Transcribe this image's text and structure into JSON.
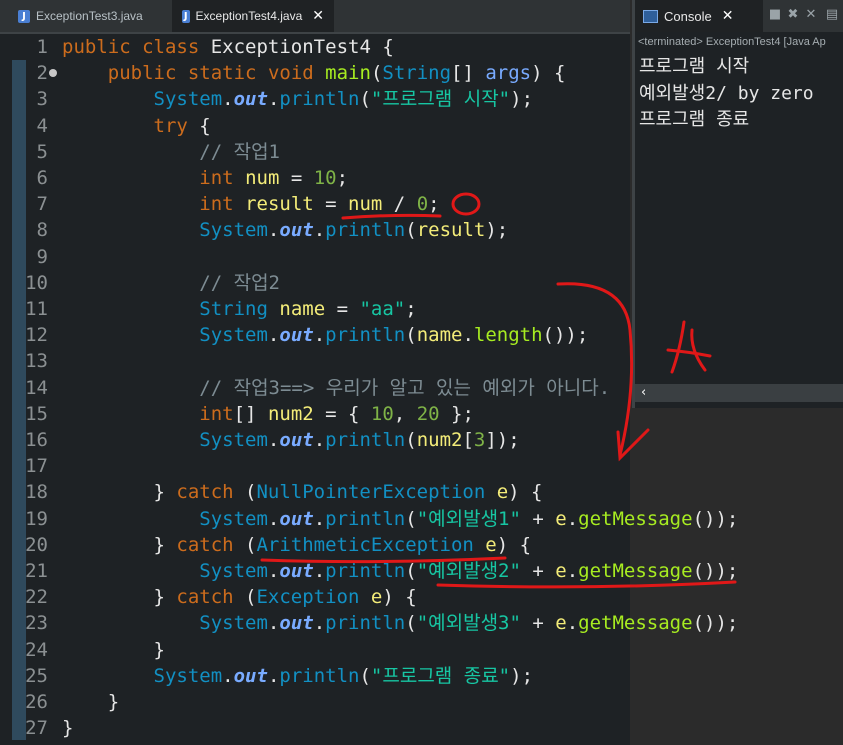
{
  "editor_tabs": [
    {
      "label": "ExceptionTest3.java",
      "active": false
    },
    {
      "label": "ExceptionTest4.java",
      "active": true,
      "close": "✕"
    }
  ],
  "console_tab": {
    "label": "Console",
    "close": "✕"
  },
  "console": {
    "terminated": "<terminated> ExceptionTest4 [Java Ap",
    "output": [
      "프로그램 시작",
      "예외발생2/ by zero",
      "프로그램 종료"
    ],
    "scroll_left": "‹"
  },
  "code_lines": [
    {
      "n": "1",
      "t": [
        [
          "kw",
          "public"
        ],
        [
          "pl",
          " "
        ],
        [
          "kw",
          "class"
        ],
        [
          "pl",
          " ExceptionTest4 {"
        ]
      ]
    },
    {
      "n": "2",
      "t": [
        [
          "pl",
          "    "
        ],
        [
          "kw",
          "public"
        ],
        [
          "pl",
          " "
        ],
        [
          "kw",
          "static"
        ],
        [
          "pl",
          " "
        ],
        [
          "kw",
          "void"
        ],
        [
          "pl",
          " "
        ],
        [
          "meth",
          "main"
        ],
        [
          "pl",
          "("
        ],
        [
          "cls",
          "String"
        ],
        [
          "pl",
          "[] "
        ],
        [
          "fld",
          "args"
        ],
        [
          "pl",
          ") {"
        ]
      ]
    },
    {
      "n": "3",
      "t": [
        [
          "pl",
          "        "
        ],
        [
          "cls",
          "System"
        ],
        [
          "pl",
          "."
        ],
        [
          "static",
          "out"
        ],
        [
          "pl",
          "."
        ],
        [
          "cls",
          "println"
        ],
        [
          "pl",
          "("
        ],
        [
          "str",
          "\"프로그램 시작\""
        ],
        [
          "pl",
          ");"
        ]
      ]
    },
    {
      "n": "4",
      "t": [
        [
          "pl",
          "        "
        ],
        [
          "kw",
          "try"
        ],
        [
          "pl",
          " {"
        ]
      ]
    },
    {
      "n": "5",
      "t": [
        [
          "pl",
          "            "
        ],
        [
          "cmt",
          "// 작업1"
        ]
      ]
    },
    {
      "n": "6",
      "t": [
        [
          "pl",
          "            "
        ],
        [
          "kw",
          "int"
        ],
        [
          "pl",
          " "
        ],
        [
          "var",
          "num"
        ],
        [
          "pl",
          " = "
        ],
        [
          "num",
          "10"
        ],
        [
          "pl",
          ";"
        ]
      ]
    },
    {
      "n": "7",
      "t": [
        [
          "pl",
          "            "
        ],
        [
          "kw",
          "int"
        ],
        [
          "pl",
          " "
        ],
        [
          "var",
          "result"
        ],
        [
          "pl",
          " = "
        ],
        [
          "var",
          "num"
        ],
        [
          "pl",
          " / "
        ],
        [
          "num",
          "0"
        ],
        [
          "pl",
          ";"
        ]
      ]
    },
    {
      "n": "8",
      "t": [
        [
          "pl",
          "            "
        ],
        [
          "cls",
          "System"
        ],
        [
          "pl",
          "."
        ],
        [
          "static",
          "out"
        ],
        [
          "pl",
          "."
        ],
        [
          "cls",
          "println"
        ],
        [
          "pl",
          "("
        ],
        [
          "var",
          "result"
        ],
        [
          "pl",
          ");"
        ]
      ]
    },
    {
      "n": "9",
      "t": [
        [
          "pl",
          ""
        ]
      ]
    },
    {
      "n": "10",
      "t": [
        [
          "pl",
          "            "
        ],
        [
          "cmt",
          "// 작업2"
        ]
      ]
    },
    {
      "n": "11",
      "t": [
        [
          "pl",
          "            "
        ],
        [
          "cls",
          "String"
        ],
        [
          "pl",
          " "
        ],
        [
          "var",
          "name"
        ],
        [
          "pl",
          " = "
        ],
        [
          "str",
          "\"aa\""
        ],
        [
          "pl",
          ";"
        ]
      ]
    },
    {
      "n": "12",
      "t": [
        [
          "pl",
          "            "
        ],
        [
          "cls",
          "System"
        ],
        [
          "pl",
          "."
        ],
        [
          "static",
          "out"
        ],
        [
          "pl",
          "."
        ],
        [
          "cls",
          "println"
        ],
        [
          "pl",
          "("
        ],
        [
          "var",
          "name"
        ],
        [
          "pl",
          "."
        ],
        [
          "meth",
          "length"
        ],
        [
          "pl",
          "());"
        ]
      ]
    },
    {
      "n": "13",
      "t": [
        [
          "pl",
          ""
        ]
      ]
    },
    {
      "n": "14",
      "t": [
        [
          "pl",
          "            "
        ],
        [
          "cmt",
          "// 작업3==> 우리가 알고 있는 예외가 아니다."
        ]
      ]
    },
    {
      "n": "15",
      "t": [
        [
          "pl",
          "            "
        ],
        [
          "kw",
          "int"
        ],
        [
          "pl",
          "[] "
        ],
        [
          "var",
          "num2"
        ],
        [
          "pl",
          " = { "
        ],
        [
          "num",
          "10"
        ],
        [
          "pl",
          ", "
        ],
        [
          "num",
          "20"
        ],
        [
          "pl",
          " };"
        ]
      ]
    },
    {
      "n": "16",
      "t": [
        [
          "pl",
          "            "
        ],
        [
          "cls",
          "System"
        ],
        [
          "pl",
          "."
        ],
        [
          "static",
          "out"
        ],
        [
          "pl",
          "."
        ],
        [
          "cls",
          "println"
        ],
        [
          "pl",
          "("
        ],
        [
          "var",
          "num2"
        ],
        [
          "pl",
          "["
        ],
        [
          "num",
          "3"
        ],
        [
          "pl",
          "]);"
        ]
      ]
    },
    {
      "n": "17",
      "t": [
        [
          "pl",
          ""
        ]
      ]
    },
    {
      "n": "18",
      "t": [
        [
          "pl",
          "        } "
        ],
        [
          "kw",
          "catch"
        ],
        [
          "pl",
          " ("
        ],
        [
          "cls",
          "NullPointerException"
        ],
        [
          "pl",
          " "
        ],
        [
          "var",
          "e"
        ],
        [
          "pl",
          ") {"
        ]
      ]
    },
    {
      "n": "19",
      "t": [
        [
          "pl",
          "            "
        ],
        [
          "cls",
          "System"
        ],
        [
          "pl",
          "."
        ],
        [
          "static",
          "out"
        ],
        [
          "pl",
          "."
        ],
        [
          "cls",
          "println"
        ],
        [
          "pl",
          "("
        ],
        [
          "str",
          "\"예외발생1\""
        ],
        [
          "pl",
          " + "
        ],
        [
          "var",
          "e"
        ],
        [
          "pl",
          "."
        ],
        [
          "meth",
          "getMessage"
        ],
        [
          "pl",
          "());"
        ]
      ]
    },
    {
      "n": "20",
      "t": [
        [
          "pl",
          "        } "
        ],
        [
          "kw",
          "catch"
        ],
        [
          "pl",
          " ("
        ],
        [
          "cls",
          "ArithmeticException"
        ],
        [
          "pl",
          " "
        ],
        [
          "var",
          "e"
        ],
        [
          "pl",
          ") {"
        ]
      ]
    },
    {
      "n": "21",
      "t": [
        [
          "pl",
          "            "
        ],
        [
          "cls",
          "System"
        ],
        [
          "pl",
          "."
        ],
        [
          "static",
          "out"
        ],
        [
          "pl",
          "."
        ],
        [
          "cls",
          "println"
        ],
        [
          "pl",
          "("
        ],
        [
          "str",
          "\"예외발생2\""
        ],
        [
          "pl",
          " + "
        ],
        [
          "var",
          "e"
        ],
        [
          "pl",
          "."
        ],
        [
          "meth",
          "getMessage"
        ],
        [
          "pl",
          "());"
        ]
      ]
    },
    {
      "n": "22",
      "t": [
        [
          "pl",
          "        } "
        ],
        [
          "kw",
          "catch"
        ],
        [
          "pl",
          " ("
        ],
        [
          "cls",
          "Exception"
        ],
        [
          "pl",
          " "
        ],
        [
          "var",
          "e"
        ],
        [
          "pl",
          ") {"
        ]
      ]
    },
    {
      "n": "23",
      "t": [
        [
          "pl",
          "            "
        ],
        [
          "cls",
          "System"
        ],
        [
          "pl",
          "."
        ],
        [
          "static",
          "out"
        ],
        [
          "pl",
          "."
        ],
        [
          "cls",
          "println"
        ],
        [
          "pl",
          "("
        ],
        [
          "str",
          "\"예외발생3\""
        ],
        [
          "pl",
          " + "
        ],
        [
          "var",
          "e"
        ],
        [
          "pl",
          "."
        ],
        [
          "meth",
          "getMessage"
        ],
        [
          "pl",
          "());"
        ]
      ]
    },
    {
      "n": "24",
      "t": [
        [
          "pl",
          "        }"
        ]
      ]
    },
    {
      "n": "25",
      "t": [
        [
          "pl",
          "        "
        ],
        [
          "cls",
          "System"
        ],
        [
          "pl",
          "."
        ],
        [
          "static",
          "out"
        ],
        [
          "pl",
          "."
        ],
        [
          "cls",
          "println"
        ],
        [
          "pl",
          "("
        ],
        [
          "str",
          "\"프로그램 종료\""
        ],
        [
          "pl",
          ");"
        ]
      ]
    },
    {
      "n": "26",
      "t": [
        [
          "pl",
          "    }"
        ]
      ]
    },
    {
      "n": "27",
      "t": [
        [
          "pl",
          "}"
        ]
      ]
    }
  ],
  "colors": {
    "annotation_red": "#e01818"
  }
}
